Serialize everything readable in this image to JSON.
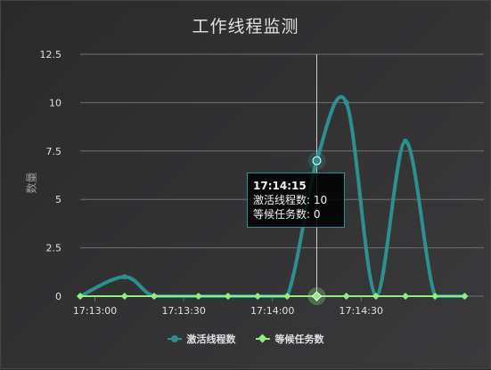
{
  "chart_data": {
    "type": "line",
    "title": "工作线程监测",
    "ylabel": "数量",
    "xlabel": "",
    "ylim": [
      0,
      12.5
    ],
    "y_ticks": [
      "0",
      "2.5",
      "5",
      "7.5",
      "10",
      "12.5"
    ],
    "y_tick_values": [
      0,
      2.5,
      5,
      7.5,
      10,
      12.5
    ],
    "x_ticks": [
      "17:13:00",
      "17:13:30",
      "17:14:00",
      "17:14:30"
    ],
    "x": [
      "17:12:55",
      "17:13:00",
      "17:13:05",
      "17:13:10",
      "17:13:15",
      "17:13:20",
      "17:13:25",
      "17:13:30",
      "17:13:35",
      "17:13:40",
      "17:13:45",
      "17:13:50",
      "17:13:55",
      "17:14:00",
      "17:14:05",
      "17:14:10",
      "17:14:15",
      "17:14:20",
      "17:14:25",
      "17:14:30",
      "17:14:35",
      "17:14:40",
      "17:14:45",
      "17:14:50",
      "17:14:55",
      "17:15:00",
      "17:15:05",
      "17:15:10"
    ],
    "series": [
      {
        "name": "激活线程数",
        "color": "#2b908f",
        "marker": "circle",
        "values": [
          0,
          null,
          null,
          1,
          null,
          0,
          null,
          null,
          0,
          null,
          0,
          null,
          0,
          null,
          0,
          null,
          7,
          null,
          10,
          null,
          0,
          null,
          8,
          null,
          0,
          null,
          0,
          null
        ]
      },
      {
        "name": "等候任务数",
        "color": "#90ee7e",
        "marker": "diamond",
        "values": [
          0,
          null,
          null,
          0,
          null,
          0,
          null,
          null,
          0,
          null,
          0,
          null,
          0,
          null,
          0,
          null,
          0,
          null,
          0,
          null,
          0,
          null,
          0,
          null,
          0,
          null,
          0,
          null
        ]
      }
    ],
    "grid": true,
    "legend_position": "bottom"
  },
  "tooltip": {
    "time": "17:14:15",
    "line1": "激活线程数: 10",
    "line2": "等候任务数: 0"
  }
}
